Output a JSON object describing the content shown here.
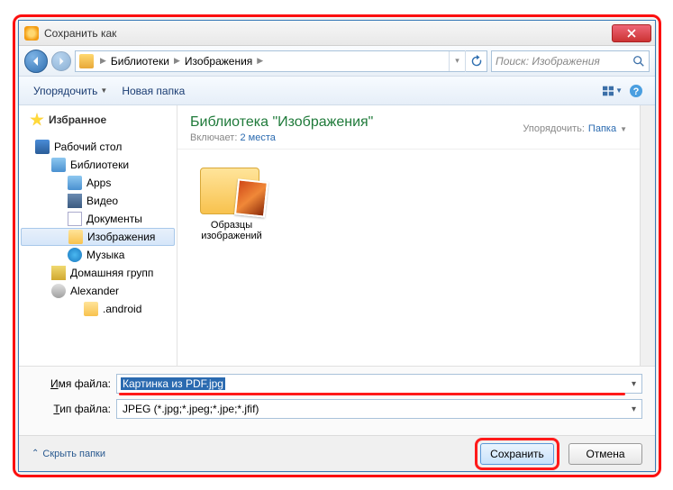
{
  "window": {
    "title": "Сохранить как"
  },
  "nav": {
    "breadcrumb": [
      "Библиотеки",
      "Изображения"
    ],
    "search_placeholder": "Поиск: Изображения"
  },
  "toolbar": {
    "organize": "Упорядочить",
    "newfolder": "Новая папка"
  },
  "sidebar": {
    "favorites": "Избранное",
    "items": [
      {
        "label": "Рабочий стол"
      },
      {
        "label": "Библиотеки"
      },
      {
        "label": "Apps"
      },
      {
        "label": "Видео"
      },
      {
        "label": "Документы"
      },
      {
        "label": "Изображения"
      },
      {
        "label": "Музыка"
      },
      {
        "label": "Домашняя групп"
      },
      {
        "label": "Alexander"
      },
      {
        "label": ".android"
      }
    ]
  },
  "main": {
    "title": "Библиотека \"Изображения\"",
    "include_label": "Включает:",
    "include_value": "2 места",
    "sort_label": "Упорядочить:",
    "sort_value": "Папка",
    "item_label": "Образцы изображений"
  },
  "fields": {
    "filename_label": "Имя файла:",
    "filename_value": "Картинка из PDF.jpg",
    "filetype_label": "Тип файла:",
    "filetype_value": "JPEG (*.jpg;*.jpeg;*.jpe;*.jfif)"
  },
  "footer": {
    "hide_folders": "Скрыть папки",
    "save": "Сохранить",
    "cancel": "Отмена"
  }
}
